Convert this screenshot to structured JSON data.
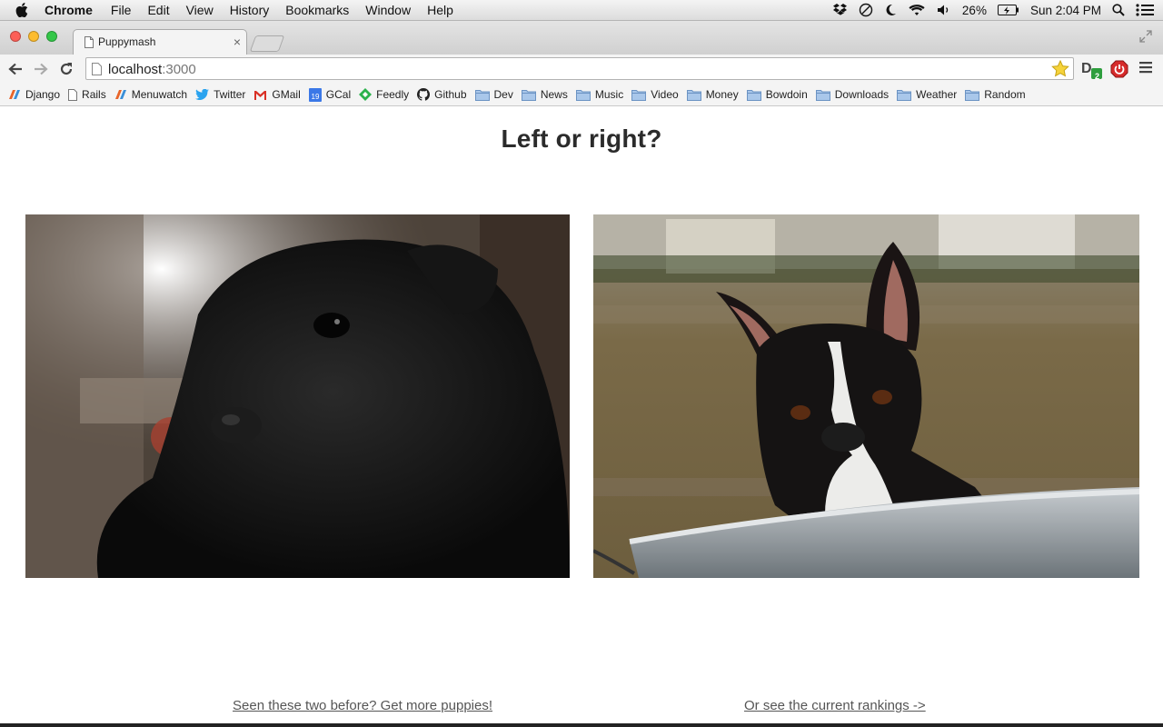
{
  "menubar": {
    "app": "Chrome",
    "items": [
      "File",
      "Edit",
      "View",
      "History",
      "Bookmarks",
      "Window",
      "Help"
    ],
    "battery": "26%",
    "clock": "Sun 2:04 PM"
  },
  "tab": {
    "title": "Puppymash"
  },
  "address": {
    "host": "localhost",
    "port": ":3000"
  },
  "extension_badge": "2",
  "bookmarks": [
    {
      "label": "Django",
      "icon": "menuwatch-logo-icon"
    },
    {
      "label": "Rails",
      "icon": "page-icon"
    },
    {
      "label": "Menuwatch",
      "icon": "menuwatch-logo-icon"
    },
    {
      "label": "Twitter",
      "icon": "twitter-bird-icon"
    },
    {
      "label": "GMail",
      "icon": "gmail-icon"
    },
    {
      "label": "GCal",
      "icon": "calendar-icon"
    },
    {
      "label": "Feedly",
      "icon": "feedly-icon"
    },
    {
      "label": "Github",
      "icon": "github-octocat-icon"
    },
    {
      "label": "Dev",
      "icon": "folder-icon"
    },
    {
      "label": "News",
      "icon": "folder-icon"
    },
    {
      "label": "Music",
      "icon": "folder-icon"
    },
    {
      "label": "Video",
      "icon": "folder-icon"
    },
    {
      "label": "Money",
      "icon": "folder-icon"
    },
    {
      "label": "Bowdoin",
      "icon": "folder-icon"
    },
    {
      "label": "Downloads",
      "icon": "folder-icon"
    },
    {
      "label": "Weather",
      "icon": "folder-icon"
    },
    {
      "label": "Random",
      "icon": "folder-icon"
    }
  ],
  "gcal_day": "19",
  "page": {
    "heading": "Left or right?",
    "left_photo": "black puppy photo",
    "right_photo": "boston terrier in tub photo",
    "more_link": "Seen these two before? Get more puppies!",
    "rankings_link": "Or see the current rankings ->"
  },
  "colors": {
    "link": "#555555",
    "heading": "#2b2b2b"
  }
}
